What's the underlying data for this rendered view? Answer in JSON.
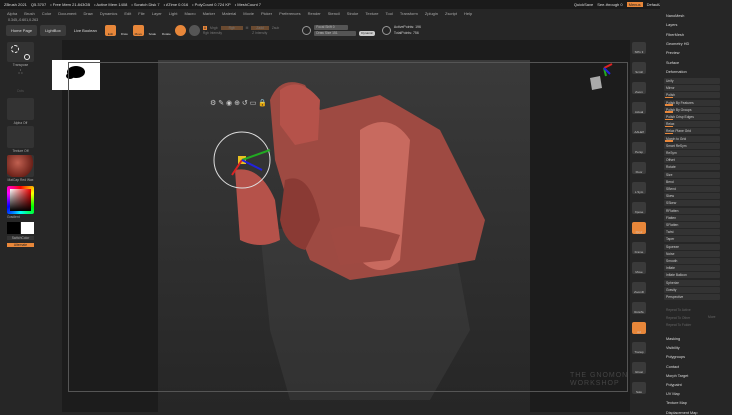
{
  "title_bar": {
    "app": "ZBrush 2021",
    "version": "Q5.3707",
    "free_mem": "• Free Mem 21.843GB",
    "active_mem": "• Active Mem 1408",
    "scratch": "• Scratch Disk 7",
    "atime": "• ATime 0.016",
    "polycount": "• PolyCount 0.724 KP",
    "meshcount": "• MeshCount 7",
    "quicksave": "QuickSave",
    "see_through": "See-through 0",
    "menus": "Menus",
    "script": "DefaultZScript"
  },
  "menu": [
    "Alpha",
    "Brush",
    "Color",
    "Document",
    "Draw",
    "Dynamics",
    "Edit",
    "File",
    "Layer",
    "Light",
    "Macro",
    "Marker",
    "Material",
    "Movie",
    "Picker",
    "Preferences",
    "Render",
    "Stencil",
    "Stroke",
    "Texture",
    "Tool",
    "Transform",
    "Zplugin",
    "Zscript",
    "Help"
  ],
  "coords": "0.345,-0.601,0.263",
  "toolbar": {
    "home": "Home Page",
    "lightbox": "LightBox",
    "live_boolean": "Live Boolean",
    "edit": "Edit",
    "draw": "Draw",
    "move": "Move",
    "scale": "Scale",
    "rotate": "Rotate",
    "a": "A",
    "mrgb": "Mrgb",
    "rgb": "Rgb",
    "m": "M",
    "zadd": "Zadd",
    "zsub": "Zsub",
    "rgb_intensity": "Rgb Intensity",
    "z_intensity": "Z Intensity",
    "focal_shift": "Focal Shift 0",
    "draw_size": "Draw Size 151",
    "dynamic": "Dynamic",
    "active_points": "ActivePoints: 196",
    "total_points": "TotalPoints: 756"
  },
  "left_shelf": {
    "transpose": "Transpose",
    "dots": "Dots",
    "alpha": "Alpha Off",
    "texture": "Texture Off",
    "material": "MatCap Red Wax",
    "gradient": "Gradient",
    "switch_color": "SwitchColor",
    "alternate": "Alternate"
  },
  "right_toolbar": [
    "SPix 3",
    "Scroll",
    "Zoom",
    "Actual",
    "AAHalf",
    "Persp",
    "Floor",
    "L.Sym",
    "Xpose",
    "Qxyz",
    "Frame",
    "Move",
    "ZoomD",
    "RotaTe",
    "Ad",
    "Transp",
    "Ghost",
    "Solo"
  ],
  "right_panel": {
    "headers_top": [
      "NanoMesh",
      "Layers",
      "FiberMesh",
      "Geometry HD",
      "Preview",
      "Surface"
    ],
    "deformation": "Deformation",
    "deform_items": [
      "Unify",
      "Mirror",
      "Polish",
      "Polish By Features",
      "Polish By Groups",
      "Polish Crisp Edges",
      "Relax",
      "Relax Plane Grid",
      "Morph to Grid",
      "Smart ReSym",
      "ReSym",
      "Offset",
      "Rotate",
      "Size",
      "Bend",
      "SBend",
      "Skew",
      "SSkew",
      "RFlatten",
      "Flatten",
      "SFlatten",
      "Twist",
      "Taper",
      "Squeeze",
      "Noise",
      "Smooth",
      "Inflate",
      "Inflate Balloon",
      "Spherize",
      "Gravity",
      "Perspective"
    ],
    "repeat": [
      "Repeat To Active",
      "Repeat To Other",
      "Repeat To Folder"
    ],
    "repeat_extra": "More",
    "headers_bottom": [
      "Masking",
      "Visibility",
      "Polygroups",
      "Contact",
      "Morph Target",
      "Polypaint",
      "UV Map",
      "Texture Map",
      "Displacement Map"
    ]
  },
  "watermark": "THE GNOMON WORKSHOP",
  "colors": {
    "accent": "#e8873a",
    "model": "#b5524a"
  }
}
